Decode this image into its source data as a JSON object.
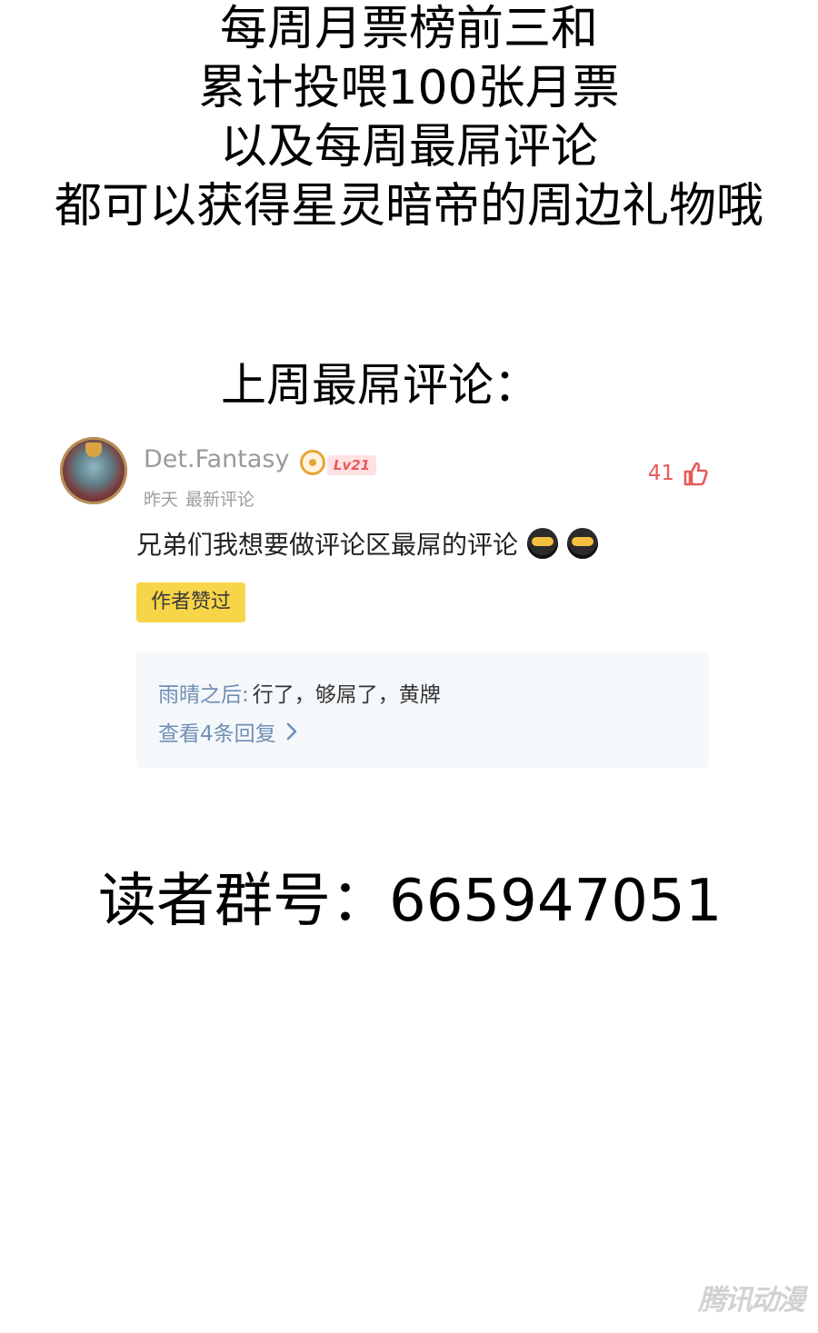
{
  "promo": {
    "lines": [
      "每周月票榜前三和",
      "累计投喂100张月票",
      "以及每周最屌评论",
      "都可以获得星灵暗帝的周边礼物哦"
    ]
  },
  "section_title": "上周最屌评论：",
  "comment": {
    "username": "Det.Fantasy",
    "level_badge": "Lv21",
    "time": "昨天",
    "label": "最新评论",
    "likes": "41",
    "text": "兄弟们我想要做评论区最屌的评论",
    "author_liked": "作者赞过",
    "reply": {
      "name": "雨晴之后",
      "colon": ":",
      "content": "行了，够屌了，黄牌"
    },
    "view_replies": "查看4条回复",
    "icons": {
      "avatar": "avatar-image",
      "level_badge_icon": "level-ring-icon",
      "likes": "thumb-up-icon",
      "emoji": "laughing-emoji-icon",
      "view_replies": "chevron-right-icon"
    },
    "colors": {
      "like_count": "#e85a5a",
      "level_tag_bg": "#ffe1e4",
      "author_liked_bg": "#f7d548",
      "reply_name": "#6f8fb4",
      "reply_box_bg": "#f5f8fb"
    }
  },
  "reader_group": "读者群号：665947051",
  "watermark": "腾讯动漫"
}
